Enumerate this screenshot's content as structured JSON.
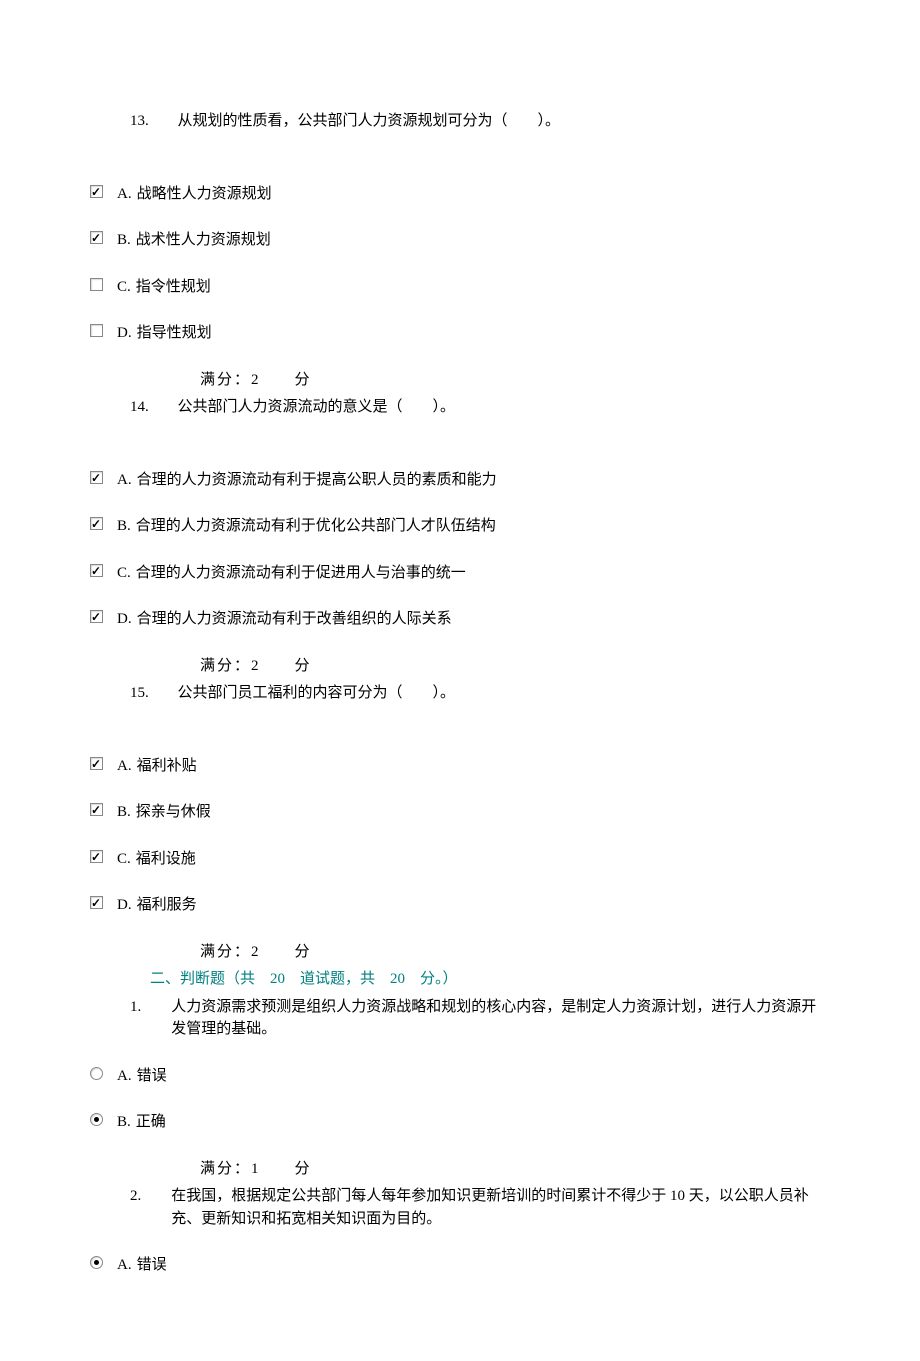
{
  "questions": [
    {
      "number": "13.",
      "text": "从规划的性质看，公共部门人力资源规划可分为（　　）。",
      "score_label": "满分：2　　分",
      "options": [
        {
          "label": "A.",
          "text": "战略性人力资源规划",
          "checked": true
        },
        {
          "label": "B.",
          "text": "战术性人力资源规划",
          "checked": true
        },
        {
          "label": "C.",
          "text": "指令性规划",
          "checked": false
        },
        {
          "label": "D.",
          "text": "指导性规划",
          "checked": false
        }
      ]
    },
    {
      "number": "14.",
      "text": "公共部门人力资源流动的意义是（　　）。",
      "score_label": "满分：2　　分",
      "options": [
        {
          "label": "A.",
          "text": "合理的人力资源流动有利于提高公职人员的素质和能力",
          "checked": true
        },
        {
          "label": "B.",
          "text": "合理的人力资源流动有利于优化公共部门人才队伍结构",
          "checked": true
        },
        {
          "label": "C.",
          "text": "合理的人力资源流动有利于促进用人与治事的统一",
          "checked": true
        },
        {
          "label": "D.",
          "text": "合理的人力资源流动有利于改善组织的人际关系",
          "checked": true
        }
      ]
    },
    {
      "number": "15.",
      "text": "公共部门员工福利的内容可分为（　　）。",
      "score_label": "满分：2　　分",
      "options": [
        {
          "label": "A.",
          "text": "福利补贴",
          "checked": true
        },
        {
          "label": "B.",
          "text": "探亲与休假",
          "checked": true
        },
        {
          "label": "C.",
          "text": "福利设施",
          "checked": true
        },
        {
          "label": "D.",
          "text": "福利服务",
          "checked": true
        }
      ]
    }
  ],
  "section_header": "二、判断题（共　20　道试题，共　20　分。）",
  "judge_questions": [
    {
      "number": "1.",
      "text": "人力资源需求预测是组织人力资源战略和规划的核心内容，是制定人力资源计划，进行人力资源开发管理的基础。",
      "score_label": "满分：1　　分",
      "options": [
        {
          "label": "A.",
          "text": "错误",
          "selected": false
        },
        {
          "label": "B.",
          "text": "正确",
          "selected": true
        }
      ]
    },
    {
      "number": "2.",
      "text": "在我国，根据规定公共部门每人每年参加知识更新培训的时间累计不得少于 10 天，以公职人员补充、更新知识和拓宽相关知识面为目的。",
      "score_label": "",
      "options": [
        {
          "label": "A.",
          "text": "错误",
          "selected": true
        }
      ]
    }
  ]
}
